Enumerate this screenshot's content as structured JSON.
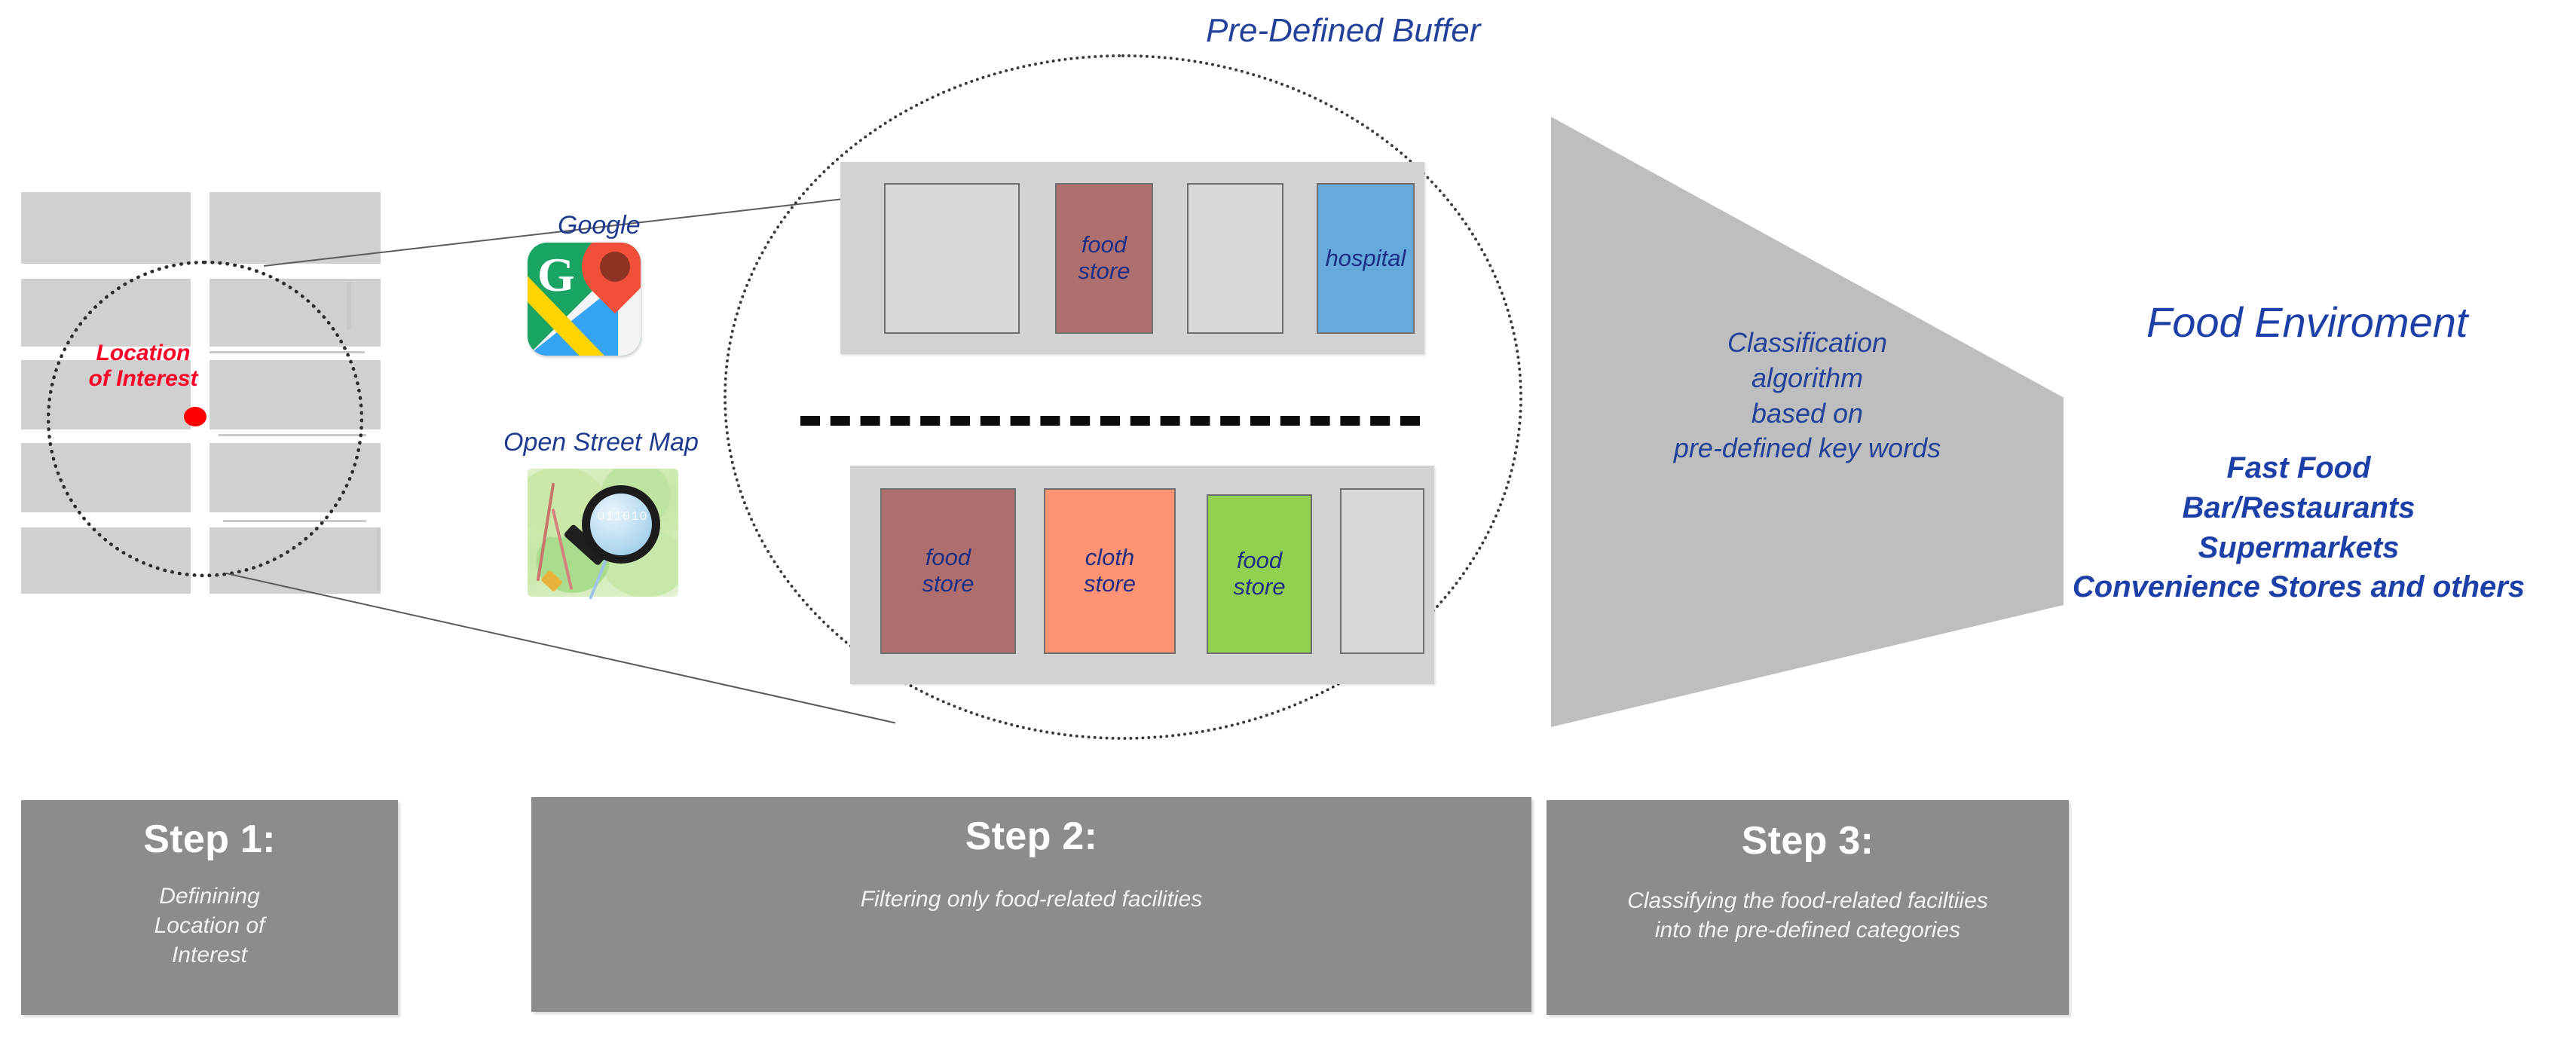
{
  "diagram": {
    "title_buffer": "Pre-Defined Buffer",
    "location_of_interest": {
      "line1": "Location",
      "line2": "of Interest"
    },
    "data_sources": [
      {
        "label": "Google",
        "icon": "google-maps-icon"
      },
      {
        "label": "Open Street Map",
        "icon": "open-street-map-magnifier-icon"
      }
    ],
    "buffer_scene": {
      "top_block": {
        "units": [
          {
            "label": "",
            "color": "#d8d8d8",
            "kind": "empty"
          },
          {
            "label": "food\nstore",
            "line1": "food",
            "line2": "store",
            "color": "#b06f6f",
            "kind": "food-store"
          },
          {
            "label": "",
            "color": "#d8d8d8",
            "kind": "empty"
          },
          {
            "label": "hospital",
            "line1": "hospital",
            "line2": "",
            "color": "#66a9dc",
            "kind": "hospital"
          }
        ]
      },
      "road_separator": "dashed-road",
      "bottom_block": {
        "units": [
          {
            "label": "food\nstore",
            "line1": "food",
            "line2": "store",
            "color": "#b06f6f",
            "kind": "food-store"
          },
          {
            "label": "cloth\nstore",
            "line1": "cloth",
            "line2": "store",
            "color": "#ff9373",
            "kind": "cloth-store"
          },
          {
            "label": "food\nstore",
            "line1": "food",
            "line2": "store",
            "color": "#92d050",
            "kind": "food-store"
          },
          {
            "label": "",
            "color": "#d8d8d8",
            "kind": "empty"
          }
        ]
      }
    },
    "funnel": {
      "line1": "Classification",
      "line2": "algorithm",
      "line3": "based on",
      "line4": "pre-defined key words"
    },
    "output": {
      "title": "Food Enviroment",
      "categories": [
        "Fast Food",
        "Bar/Restaurants",
        "Supermarkets",
        "Convenience Stores and others"
      ]
    },
    "steps": [
      {
        "title": "Step 1:",
        "sub_line1": "Definining",
        "sub_line2": "Location of",
        "sub_line3": "Interest"
      },
      {
        "title": "Step 2:",
        "sub_line1": "Filtering only food-related facilities",
        "sub_line2": "",
        "sub_line3": ""
      },
      {
        "title": "Step 3:",
        "sub_line1": "Classifying the food-related faciltiies",
        "sub_line2": "into the pre-defined categories",
        "sub_line3": ""
      }
    ],
    "colors": {
      "block_gray": "#d0d0d0",
      "strip_gray": "#d2d2d2",
      "step_gray": "#8c8c8c",
      "funnel_gray": "#bebebe",
      "navy_text": "#23409a",
      "red_marker": "#ff0000",
      "food_store_red": "#b06f6f",
      "cloth_store_salmon": "#ff9373",
      "food_store_green": "#92d050",
      "hospital_blue": "#66a9dc"
    }
  }
}
